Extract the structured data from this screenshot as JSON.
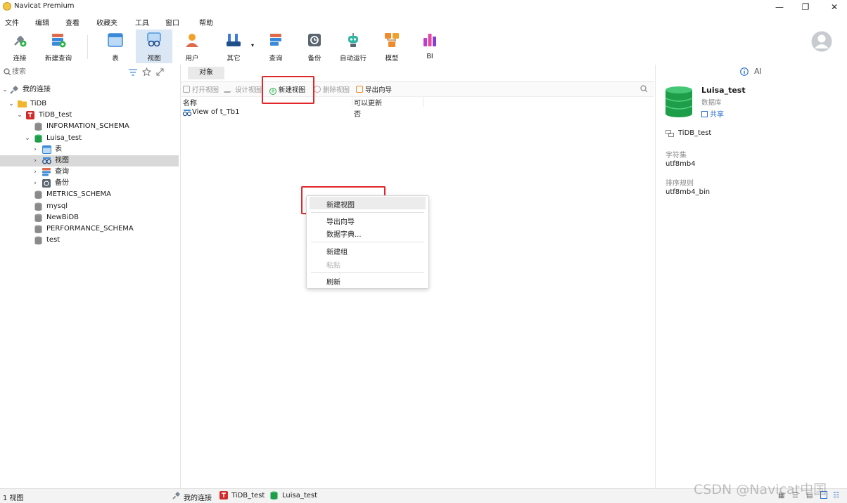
{
  "window": {
    "title": "Navicat Premium",
    "controls": [
      "✕",
      "❐",
      "—"
    ]
  },
  "menubar": [
    "文件",
    "编辑",
    "查看",
    "收藏夹",
    "工具",
    "窗口",
    "帮助"
  ],
  "toolbar": {
    "items": [
      {
        "label": "连接",
        "icon": "connection-icon",
        "color": "#7a8591"
      },
      {
        "label": "新建查询",
        "icon": "new-query-icon",
        "color": "#e06a4e"
      },
      {
        "label": "表",
        "icon": "table-icon",
        "color": "#3b8ad9"
      },
      {
        "label": "视图",
        "icon": "view-icon",
        "color": "#3b8ad9",
        "active": true
      },
      {
        "label": "用户",
        "icon": "user-icon",
        "color": "#f0a12a"
      },
      {
        "label": "其它",
        "icon": "tools-icon",
        "color": "#3b7bd4"
      },
      {
        "label": "查询",
        "icon": "query-icon",
        "color": "#e06a4e"
      },
      {
        "label": "备份",
        "icon": "backup-icon",
        "color": "#5a6570"
      },
      {
        "label": "自动运行",
        "icon": "robot-icon",
        "color": "#2fb5a3"
      },
      {
        "label": "模型",
        "icon": "model-icon",
        "color": "#f08a2a"
      },
      {
        "label": "BI",
        "icon": "bi-icon",
        "color": "#c43bd1"
      }
    ]
  },
  "leftpanel": {
    "search_placeholder": "搜索",
    "tree": [
      {
        "label": "我的连接",
        "level": 0,
        "icon": "my-connections-icon"
      },
      {
        "label": "TiDB",
        "level": 1,
        "icon": "folder-icon",
        "expanded": true
      },
      {
        "label": "TiDB_test",
        "level": 2,
        "icon": "tidb-connection-icon",
        "expanded": true
      },
      {
        "label": "INFORMATION_SCHEMA",
        "level": 3,
        "icon": "database-icon"
      },
      {
        "label": "Luisa_test",
        "level": 3,
        "icon": "database-active-icon",
        "expanded": true
      },
      {
        "label": "表",
        "level": 4,
        "icon": "table-icon",
        "collapsed": true
      },
      {
        "label": "视图",
        "level": 4,
        "icon": "view-icon",
        "collapsed": true,
        "selected": true
      },
      {
        "label": "查询",
        "level": 4,
        "icon": "query-icon",
        "collapsed": true
      },
      {
        "label": "备份",
        "level": 4,
        "icon": "backup-icon",
        "collapsed": true
      },
      {
        "label": "METRICS_SCHEMA",
        "level": 3,
        "icon": "database-icon"
      },
      {
        "label": "mysql",
        "level": 3,
        "icon": "database-icon"
      },
      {
        "label": "NewBiDB",
        "level": 3,
        "icon": "database-icon"
      },
      {
        "label": "PERFORMANCE_SCHEMA",
        "level": 3,
        "icon": "database-icon"
      },
      {
        "label": "test",
        "level": 3,
        "icon": "database-icon"
      }
    ]
  },
  "midpanel": {
    "tab": "对象",
    "objtoolbar": [
      {
        "label": "打开视图",
        "enabled": false
      },
      {
        "label": "设计视图",
        "enabled": false
      },
      {
        "label": "新建视图",
        "enabled": true
      },
      {
        "label": "删除视图",
        "enabled": false
      },
      {
        "label": "导出向导",
        "enabled": true
      }
    ],
    "columns": [
      "名称",
      "可以更新"
    ],
    "rows": [
      {
        "name": "View of t_Tb1",
        "updatable": "否"
      }
    ]
  },
  "contextmenu": {
    "groups": [
      [
        {
          "label": "新建视图",
          "enabled": true,
          "highlighted": true
        }
      ],
      [
        {
          "label": "导出向导",
          "enabled": true
        },
        {
          "label": "数据字典...",
          "enabled": true
        }
      ],
      [
        {
          "label": "新建组",
          "enabled": true
        },
        {
          "label": "粘贴",
          "enabled": false
        }
      ],
      [
        {
          "label": "刷新",
          "enabled": true
        }
      ]
    ]
  },
  "rightpanel": {
    "db_name": "Luisa_test",
    "db_type": "数据库",
    "share": "共享",
    "ai": "AI",
    "connection": "TiDB_test",
    "charset_label": "字符集",
    "charset_value": "utf8mb4",
    "collation_label": "排序规则",
    "collation_value": "utf8mb4_bin"
  },
  "statusbar": {
    "count": "1 视图",
    "crumbs": [
      "我的连接",
      "TiDB_test",
      "Luisa_test"
    ]
  },
  "watermark": "CSDN @Navicat中国",
  "accent": "#e0272b"
}
